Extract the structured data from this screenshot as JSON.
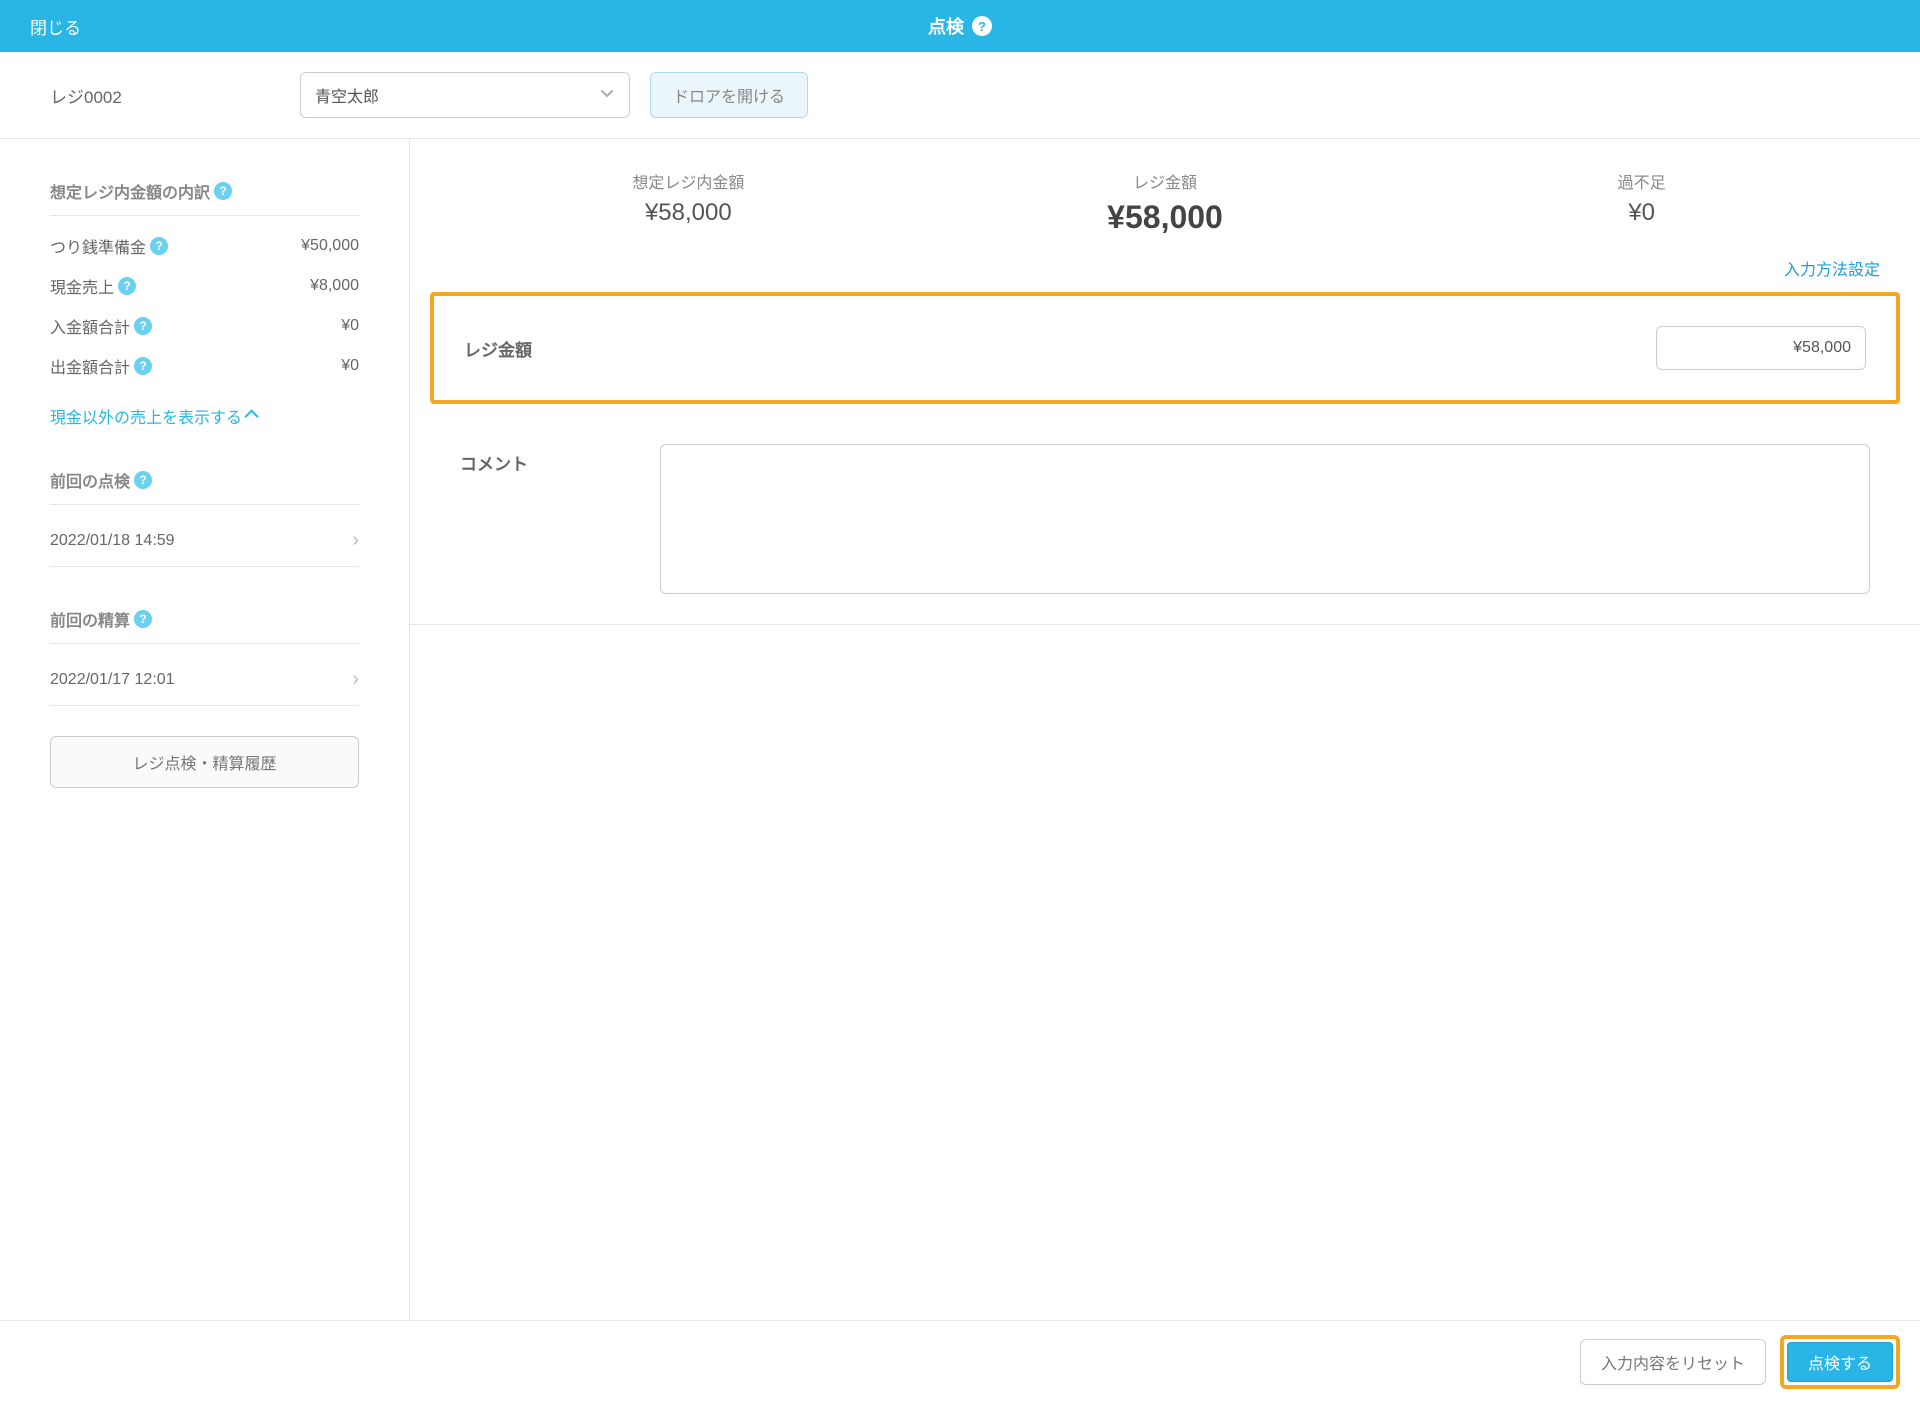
{
  "header": {
    "close": "閉じる",
    "title": "点検"
  },
  "controlBar": {
    "registerLabel": "レジ0002",
    "staffName": "青空太郎",
    "drawerBtn": "ドロアを開ける"
  },
  "sidebar": {
    "breakdownHeading": "想定レジ内金額の内訳",
    "items": [
      {
        "label": "つり銭準備金",
        "value": "¥50,000"
      },
      {
        "label": "現金売上",
        "value": "¥8,000"
      },
      {
        "label": "入金額合計",
        "value": "¥0"
      },
      {
        "label": "出金額合計",
        "value": "¥0"
      }
    ],
    "showNonCash": "現金以外の売上を表示する",
    "lastCheck": {
      "heading": "前回の点検",
      "value": "2022/01/18 14:59"
    },
    "lastSettlement": {
      "heading": "前回の精算",
      "value": "2022/01/17 12:01"
    },
    "historyBtn": "レジ点検・精算履歴"
  },
  "summary": {
    "expected": {
      "label": "想定レジ内金額",
      "value": "¥58,000"
    },
    "actual": {
      "label": "レジ金額",
      "value": "¥58,000"
    },
    "diff": {
      "label": "過不足",
      "value": "¥0"
    }
  },
  "inputSettings": "入力方法設定",
  "amountRow": {
    "label": "レジ金額",
    "value": "¥58,000"
  },
  "commentRow": {
    "label": "コメント",
    "value": ""
  },
  "footer": {
    "reset": "入力内容をリセット",
    "submit": "点検する"
  }
}
